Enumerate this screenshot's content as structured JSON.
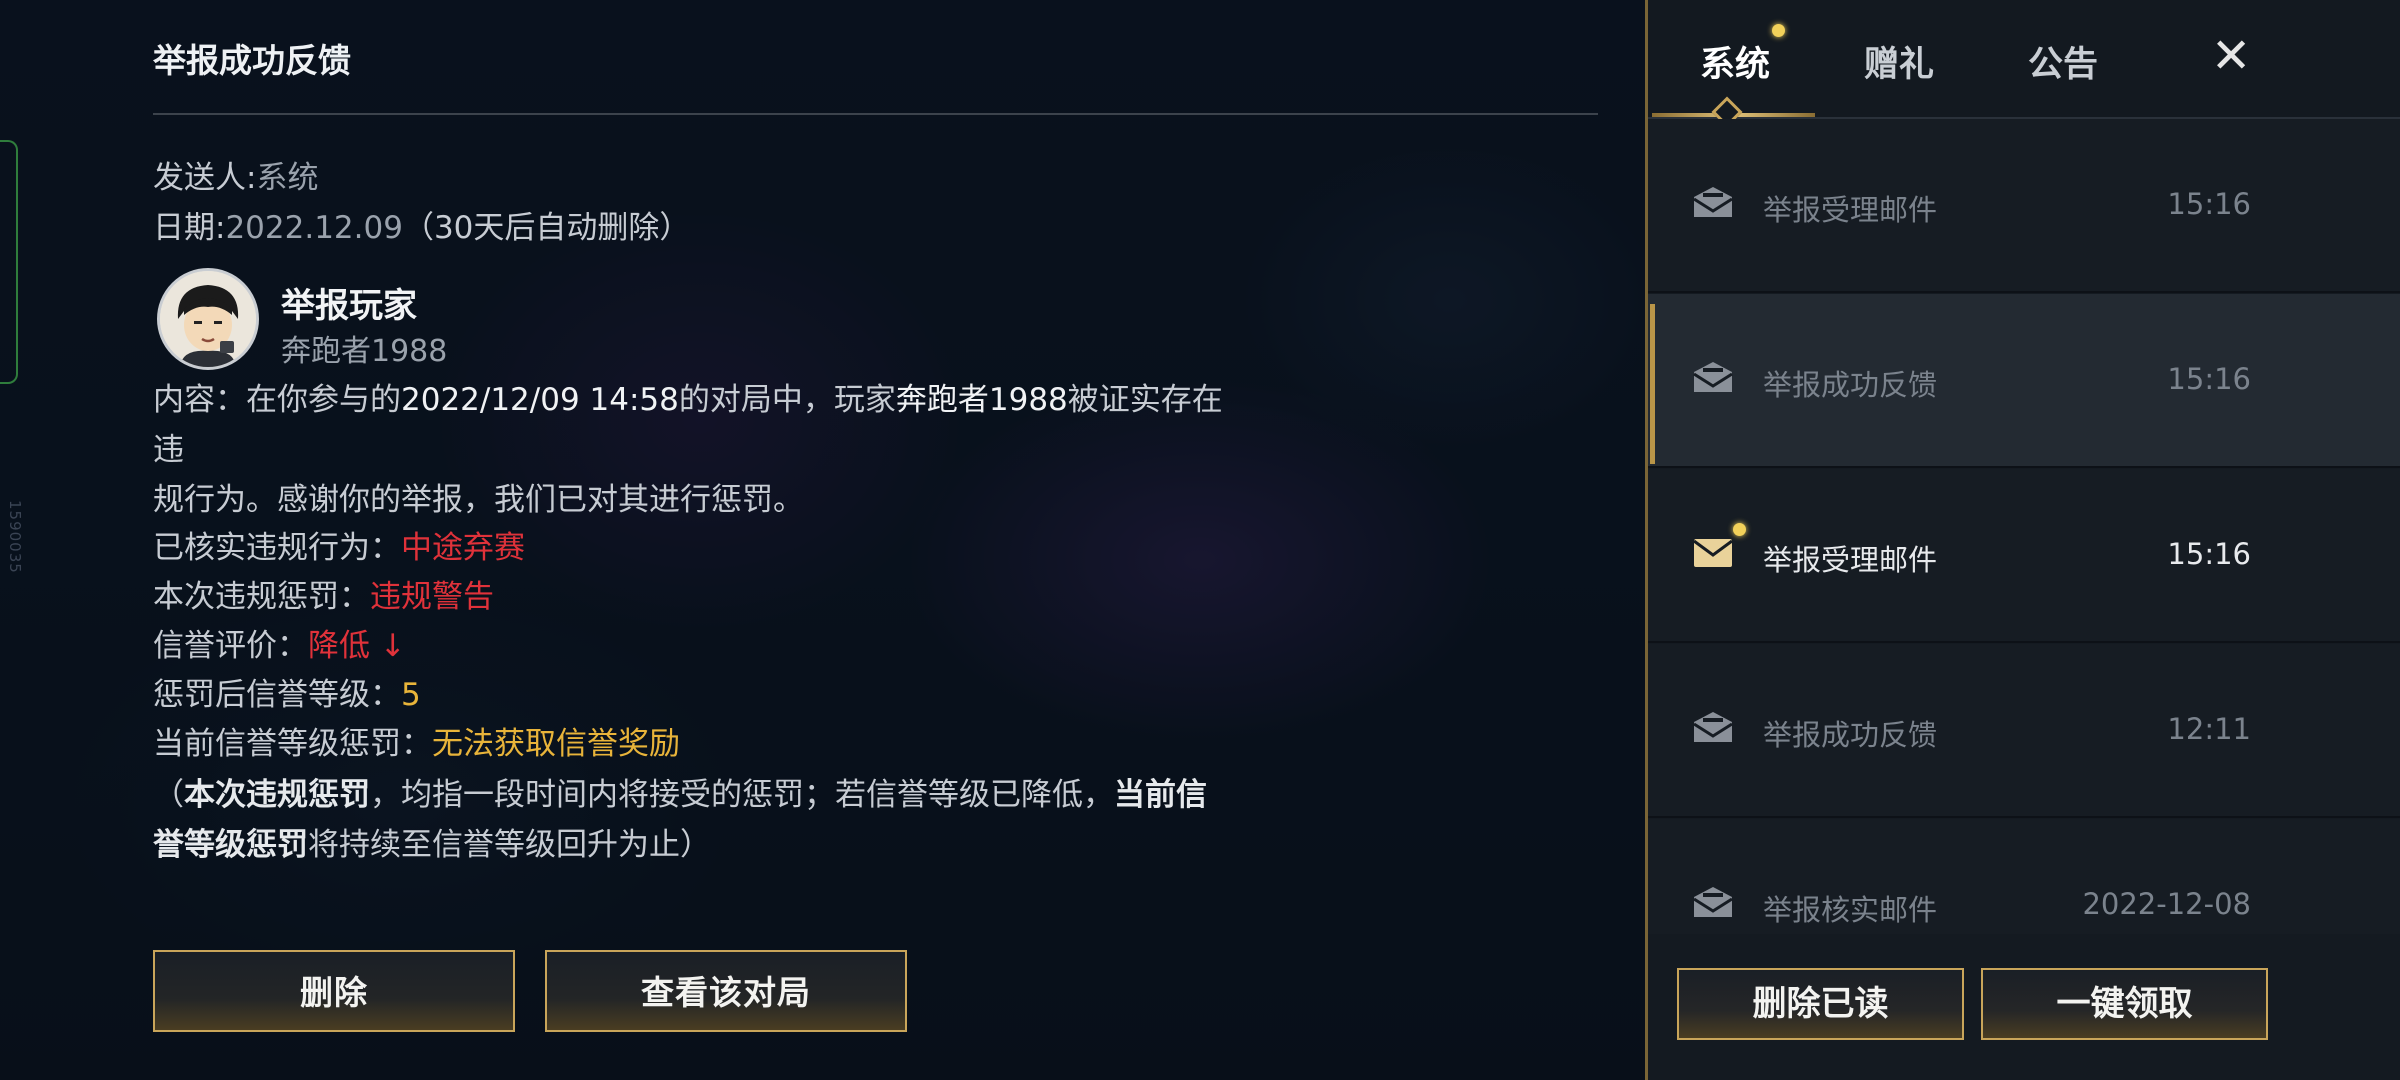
{
  "edge_id": "1590035",
  "mail": {
    "title": "举报成功反馈",
    "sender_key": "发送人:",
    "sender_value": "系统",
    "date_key": "日期:",
    "date_value": "2022.12.09",
    "date_note": "（30天后自动删除）",
    "reporter_title": "举报玩家",
    "reporter_name": "奔跑者1988",
    "content_intro": "内容：在你参与的",
    "content_time": "2022/12/09 14:58",
    "content_mid": "的对局中，玩家",
    "content_player": "奔跑者1988",
    "content_tail": "被证实存在违",
    "content_line2": "规行为。感谢你的举报，我们已对其进行惩罚。",
    "rows": [
      {
        "key": "已核实违规行为：",
        "value": "中途弃赛",
        "color": "#e0323a"
      },
      {
        "key": "本次违规惩罚：",
        "value": "违规警告",
        "color": "#e0323a"
      },
      {
        "key": "信誉评价：",
        "value": "降低 ↓",
        "color": "#e0323a"
      },
      {
        "key": "惩罚后信誉等级：",
        "value": "5",
        "color": "#e8b43a"
      },
      {
        "key": "当前信誉等级惩罚：",
        "value": "无法获取信誉奖励",
        "color": "#e8b43a"
      }
    ],
    "note_open": "（",
    "note_b1": "本次违规惩罚",
    "note_mid": "，均指一段时间内将接受的惩罚；若信誉等级已降低，",
    "note_b2a": "当前信",
    "note_b2b": "誉等级惩罚",
    "note_tail": "将持续至信誉等级回升为止）",
    "delete_label": "删除",
    "view_match_label": "查看该对局"
  },
  "panel": {
    "tabs": [
      {
        "label": "系统",
        "active": true,
        "has_dot": true
      },
      {
        "label": "赠礼",
        "active": false
      },
      {
        "label": "公告",
        "active": false
      }
    ],
    "close_label": "✕",
    "items": [
      {
        "label": "举报受理邮件",
        "time": "15:16",
        "state": "read"
      },
      {
        "label": "举报成功反馈",
        "time": "15:16",
        "state": "selected"
      },
      {
        "label": "举报受理邮件",
        "time": "15:16",
        "state": "unread"
      },
      {
        "label": "举报成功反馈",
        "time": "12:11",
        "state": "read"
      },
      {
        "label": "举报核实邮件",
        "time": "2022-12-08",
        "state": "read"
      }
    ],
    "delete_read_label": "删除已读",
    "claim_all_label": "一键领取"
  },
  "colors": {
    "accent_gold": "#c9a55a",
    "warning_red": "#e0323a",
    "highlight_gold": "#e8b43a"
  }
}
